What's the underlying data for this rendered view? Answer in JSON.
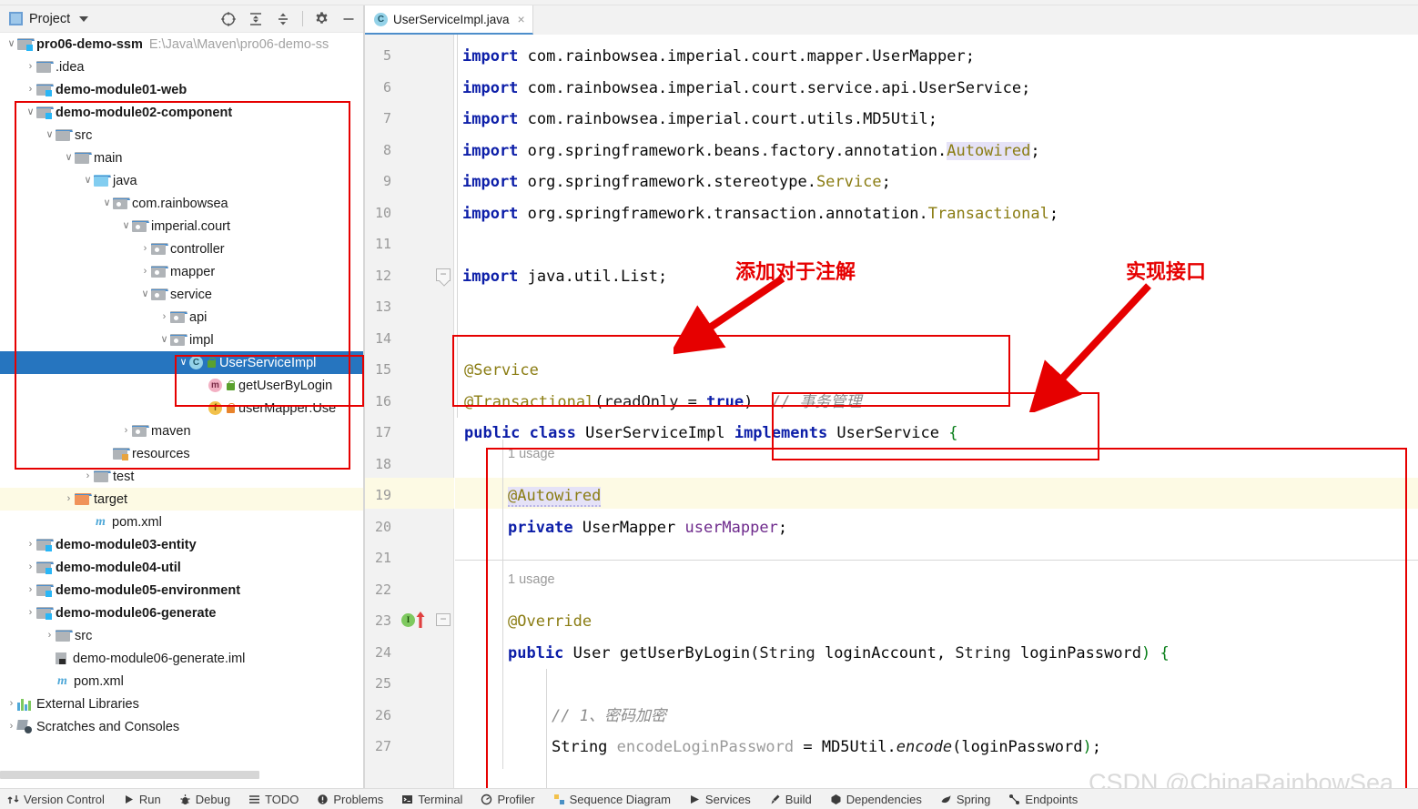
{
  "project_panel": {
    "title": "Project",
    "icons": [
      "project-select-icon",
      "expand-all-icon",
      "collapse-all-icon",
      "settings-gear-icon",
      "minimize-icon"
    ],
    "tree": [
      {
        "label": "pro06-demo-ssm",
        "note": "E:\\Java\\Maven\\pro06-demo-ss",
        "arrow": "v",
        "icon": "module-folder-icon",
        "depth": 0,
        "bold": true
      },
      {
        "label": ".idea",
        "note": "",
        "arrow": ">",
        "icon": "folder-icon",
        "depth": 1,
        "bold": false
      },
      {
        "label": "demo-module01-web",
        "note": "",
        "arrow": ">",
        "icon": "module-folder-icon",
        "depth": 1,
        "bold": true
      },
      {
        "label": "demo-module02-component",
        "note": "",
        "arrow": "v",
        "icon": "module-folder-icon",
        "depth": 1,
        "bold": true
      },
      {
        "label": "src",
        "note": "",
        "arrow": "v",
        "icon": "folder-icon",
        "depth": 2,
        "bold": false
      },
      {
        "label": "main",
        "note": "",
        "arrow": "v",
        "icon": "folder-icon",
        "depth": 3,
        "bold": false
      },
      {
        "label": "java",
        "note": "",
        "arrow": "v",
        "icon": "source-folder-icon",
        "depth": 4,
        "bold": false
      },
      {
        "label": "com.rainbowsea",
        "note": "",
        "arrow": "v",
        "icon": "package-icon",
        "depth": 5,
        "bold": false
      },
      {
        "label": "imperial.court",
        "note": "",
        "arrow": "v",
        "icon": "package-icon",
        "depth": 6,
        "bold": false
      },
      {
        "label": "controller",
        "note": "",
        "arrow": ">",
        "icon": "package-icon",
        "depth": 7,
        "bold": false
      },
      {
        "label": "mapper",
        "note": "",
        "arrow": ">",
        "icon": "package-icon",
        "depth": 7,
        "bold": false
      },
      {
        "label": "service",
        "note": "",
        "arrow": "v",
        "icon": "package-icon",
        "depth": 7,
        "bold": false
      },
      {
        "label": "api",
        "note": "",
        "arrow": ">",
        "icon": "package-icon",
        "depth": 8,
        "bold": false
      },
      {
        "label": "impl",
        "note": "",
        "arrow": "v",
        "icon": "package-icon",
        "depth": 8,
        "bold": false
      },
      {
        "label": "UserServiceImpl",
        "note": "",
        "arrow": "v",
        "icon": "java-class-icon",
        "depth": 9,
        "bold": false,
        "selected": true,
        "lock": "green"
      },
      {
        "label": "getUserByLogin",
        "note": "",
        "arrow": "",
        "icon": "java-method-icon",
        "depth": 10,
        "bold": false,
        "lock": "green"
      },
      {
        "label": "userMapper:Use",
        "note": "",
        "arrow": "",
        "icon": "java-field-icon",
        "depth": 10,
        "bold": false,
        "lock": "orange"
      },
      {
        "label": "maven",
        "note": "",
        "arrow": ">",
        "icon": "package-icon",
        "depth": 6,
        "bold": false
      },
      {
        "label": "resources",
        "note": "",
        "arrow": "",
        "icon": "resources-folder-icon",
        "depth": 5,
        "bold": false
      },
      {
        "label": "test",
        "note": "",
        "arrow": ">",
        "icon": "folder-icon",
        "depth": 4,
        "bold": false
      },
      {
        "label": "target",
        "note": "",
        "arrow": ">",
        "icon": "target-folder-icon",
        "depth": 3,
        "bold": false,
        "highlight": true
      },
      {
        "label": "pom.xml",
        "note": "",
        "arrow": "",
        "icon": "maven-pom-icon",
        "depth": 4,
        "bold": false
      },
      {
        "label": "demo-module03-entity",
        "note": "",
        "arrow": ">",
        "icon": "module-folder-icon",
        "depth": 1,
        "bold": true
      },
      {
        "label": "demo-module04-util",
        "note": "",
        "arrow": ">",
        "icon": "module-folder-icon",
        "depth": 1,
        "bold": true
      },
      {
        "label": "demo-module05-environment",
        "note": "",
        "arrow": ">",
        "icon": "module-folder-icon",
        "depth": 1,
        "bold": true
      },
      {
        "label": "demo-module06-generate",
        "note": "",
        "arrow": ">",
        "icon": "module-folder-icon",
        "depth": 1,
        "bold": true
      },
      {
        "label": "src",
        "note": "",
        "arrow": ">",
        "icon": "folder-icon",
        "depth": 2,
        "bold": false
      },
      {
        "label": "demo-module06-generate.iml",
        "note": "",
        "arrow": "",
        "icon": "iml-file-icon",
        "depth": 2,
        "bold": false
      },
      {
        "label": "pom.xml",
        "note": "",
        "arrow": "",
        "icon": "maven-pom-icon",
        "depth": 2,
        "bold": false
      },
      {
        "label": "External Libraries",
        "note": "",
        "arrow": ">",
        "icon": "external-libraries-icon",
        "depth": 0,
        "bold": false
      },
      {
        "label": "Scratches and Consoles",
        "note": "",
        "arrow": ">",
        "icon": "scratches-icon",
        "depth": 0,
        "bold": false
      }
    ]
  },
  "editor": {
    "tab": {
      "label": "UserServiceImpl.java",
      "icon": "java-class-icon",
      "close": "×"
    },
    "line_numbers": [
      "5",
      "6",
      "7",
      "8",
      "9",
      "10",
      "11",
      "12",
      "13",
      "14",
      "15",
      "16",
      "17",
      "18",
      "19",
      "20",
      "21",
      "22",
      "23",
      "24",
      "25",
      "26",
      "27"
    ],
    "highlighted_line": "19",
    "gutter_markers": {
      "line": "23",
      "implements_marker": "I",
      "override_arrow": "red-up-arrow"
    },
    "code_lines": [
      "import com.rainbowsea.imperial.court.mapper.UserMapper;",
      "import com.rainbowsea.imperial.court.service.api.UserService;",
      "import com.rainbowsea.imperial.court.utils.MD5Util;",
      "import org.springframework.beans.factory.annotation.Autowired;",
      "import org.springframework.stereotype.Service;",
      "import org.springframework.transaction.annotation.Transactional;",
      "import java.util.List;",
      "@Service",
      "@Transactional(readOnly = true)  // 事务管理",
      "public class UserServiceImpl implements UserService {",
      "1 usage",
      "@Autowired",
      "private UserMapper userMapper;",
      "1 usage",
      "@Override",
      "public User getUserByLogin(String loginAccount, String loginPassword) {",
      "// 1、密码加密",
      "String encodeLoginPassword = MD5Util.encode(loginPassword);"
    ],
    "usage_hint": "1 usage"
  },
  "annotations": {
    "label_add_annotation": "添加对于注解",
    "label_implement_interface": "实现接口",
    "color": "#e60000"
  },
  "watermark": {
    "text": "CSDN @ChinaRainbowSea"
  },
  "bottom_bar": {
    "items": [
      {
        "label": "Version Control",
        "icon": "version-control-icon"
      },
      {
        "label": "Run",
        "icon": "run-icon"
      },
      {
        "label": "Debug",
        "icon": "debug-icon"
      },
      {
        "label": "TODO",
        "icon": "todo-icon"
      },
      {
        "label": "Problems",
        "icon": "problems-icon"
      },
      {
        "label": "Terminal",
        "icon": "terminal-icon"
      },
      {
        "label": "Profiler",
        "icon": "profiler-icon"
      },
      {
        "label": "Sequence Diagram",
        "icon": "sequence-diagram-icon"
      },
      {
        "label": "Services",
        "icon": "services-icon"
      },
      {
        "label": "Build",
        "icon": "build-icon"
      },
      {
        "label": "Dependencies",
        "icon": "dependencies-icon"
      },
      {
        "label": "Spring",
        "icon": "spring-icon"
      },
      {
        "label": "Endpoints",
        "icon": "endpoints-icon"
      }
    ]
  }
}
